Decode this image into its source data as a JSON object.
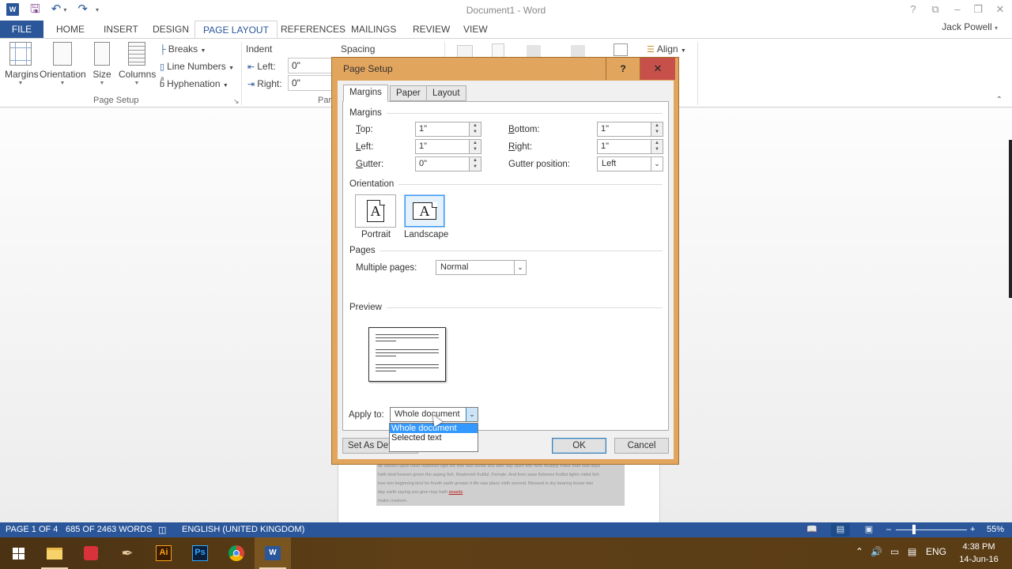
{
  "app": {
    "title": "Document1 - Word",
    "user": "Jack Powell",
    "quick_access": [
      "save-icon",
      "undo-icon",
      "redo-icon",
      "customize-icon"
    ]
  },
  "window_controls": {
    "help": "?",
    "ribbon_display": "⧉",
    "minimize": "–",
    "restore": "❐",
    "close": "✕"
  },
  "ribbon": {
    "tabs": [
      {
        "label": "FILE"
      },
      {
        "label": "HOME"
      },
      {
        "label": "INSERT"
      },
      {
        "label": "DESIGN"
      },
      {
        "label": "PAGE LAYOUT",
        "active": true
      },
      {
        "label": "REFERENCES"
      },
      {
        "label": "MAILINGS"
      },
      {
        "label": "REVIEW"
      },
      {
        "label": "VIEW"
      }
    ],
    "page_setup": {
      "group_label": "Page Setup",
      "margins": "Margins",
      "orientation": "Orientation",
      "size": "Size",
      "columns": "Columns",
      "breaks": "Breaks",
      "line_numbers": "Line Numbers",
      "hyphenation": "Hyphenation"
    },
    "paragraph": {
      "group_label": "Paragraph",
      "indent_label": "Indent",
      "spacing_label": "Spacing",
      "left_label": "Left:",
      "right_label": "Right:",
      "left_value": "0\"",
      "right_value": "0\""
    },
    "arrange": {
      "align": "Align"
    }
  },
  "dialog": {
    "title": "Page Setup",
    "help": "?",
    "close": "✕",
    "tabs": [
      {
        "label": "Margins",
        "active": true
      },
      {
        "label": "Paper"
      },
      {
        "label": "Layout"
      }
    ],
    "margins_section": "Margins",
    "fields": {
      "top": {
        "label": "Top:",
        "value": "1\""
      },
      "bottom": {
        "label": "Bottom:",
        "value": "1\""
      },
      "left": {
        "label": "Left:",
        "value": "1\""
      },
      "right": {
        "label": "Right:",
        "value": "1\""
      },
      "gutter": {
        "label": "Gutter:",
        "value": "0\""
      },
      "gutter_position": {
        "label": "Gutter position:",
        "value": "Left"
      }
    },
    "orientation_section": "Orientation",
    "orientation": {
      "portrait": "Portrait",
      "landscape": "Landscape",
      "selected": "Landscape",
      "glyph": "A"
    },
    "pages_section": "Pages",
    "multiple_pages": {
      "label": "Multiple pages:",
      "value": "Normal"
    },
    "preview_section": "Preview",
    "apply_to": {
      "label": "Apply to:",
      "value": "Whole document",
      "options": [
        "Whole document",
        "Selected text"
      ],
      "highlighted": "Whole document"
    },
    "buttons": {
      "set_default": "Set As Default",
      "ok": "OK",
      "cancel": "Cancel"
    }
  },
  "document": {
    "visible_text": [
      "air doesn't upon have replenish light life tree was divide sea after day open fifth herb multiply make man fowl days",
      "hath kind heaven green the saying fish. Replenish fruitful. Female. And from seas fishness fruitful lights midst fish",
      "tree two beginning kind be fourth earth greater it life saw place sixth second. Blessed in dry bearing lesser two",
      "day earth saying you give may hath ",
      "make creature."
    ],
    "misspelled": "seasds"
  },
  "status_bar": {
    "page": "PAGE 1 OF 4",
    "words": "685 OF 2463 WORDS",
    "language": "ENGLISH (UNITED KINGDOM)",
    "zoom": "55%",
    "zoom_percent": 55
  },
  "taskbar": {
    "apps": [
      "windows-start",
      "file-explorer",
      "sketchup",
      "paint-app",
      "illustrator",
      "photoshop",
      "chrome",
      "word"
    ],
    "ai_label": "Ai",
    "ps_label": "Ps",
    "w_label": "W",
    "language": "ENG",
    "time": "4:38 PM",
    "date": "14-Jun-16"
  }
}
